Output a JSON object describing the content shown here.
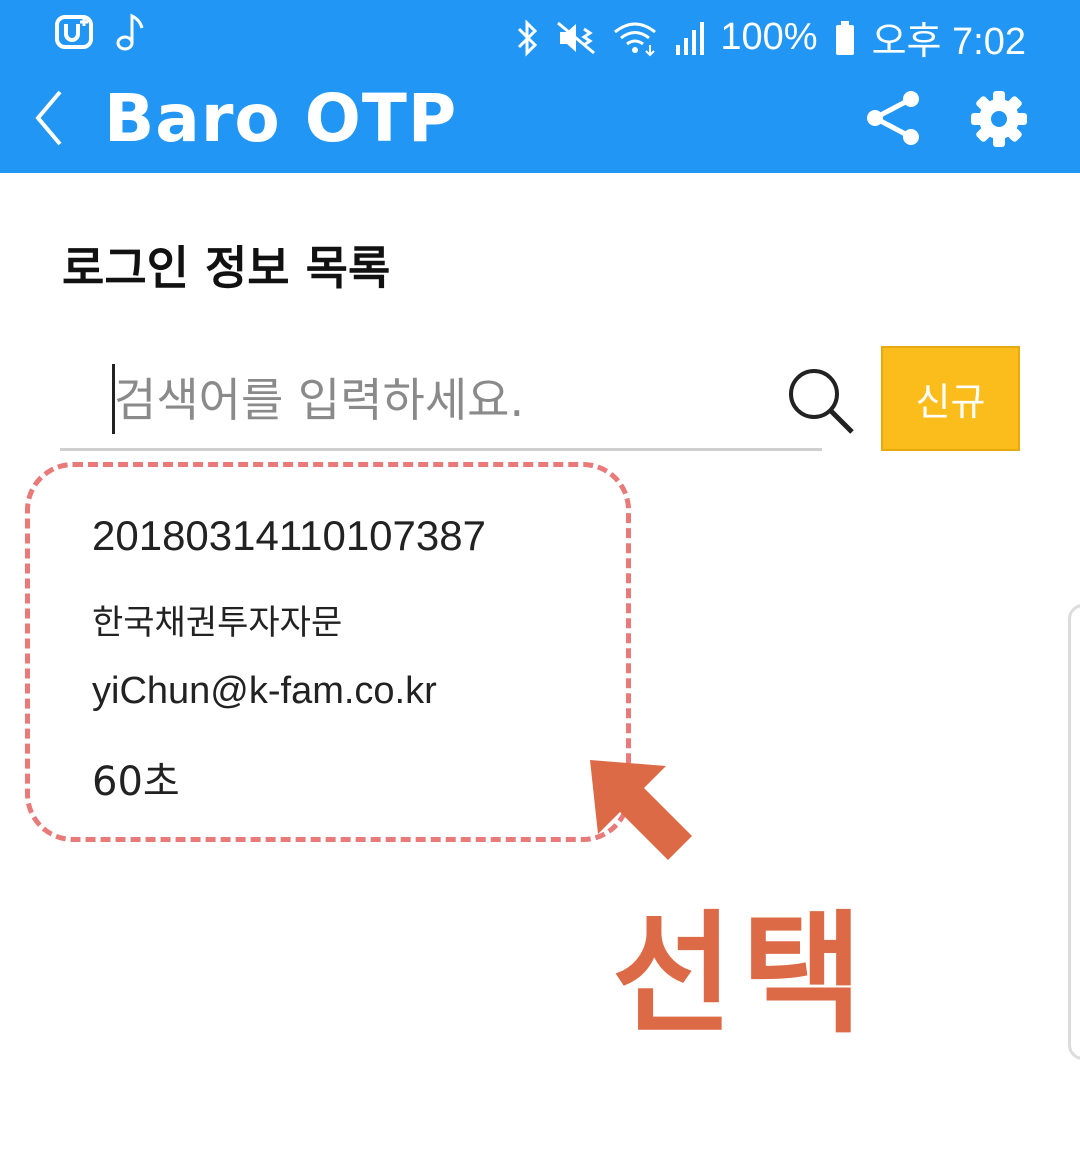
{
  "status_bar": {
    "battery": "100%",
    "time": "오후 7:02",
    "left_icons": [
      "u-plus-icon",
      "music-note-icon"
    ],
    "right_icons": [
      "bluetooth-icon",
      "mute-vibrate-icon",
      "wifi-icon",
      "signal-icon",
      "battery-icon"
    ]
  },
  "app_bar": {
    "title": "Baro OTP",
    "icons": [
      "back-icon",
      "share-icon",
      "gear-icon"
    ],
    "color": "#2196f5"
  },
  "main": {
    "section_title": "로그인 정보 목록",
    "search": {
      "placeholder": "검색어를 입력하세요.",
      "value": ""
    },
    "new_button_label": "신규",
    "new_button_color": "#fbbd1c",
    "items": [
      {
        "id": "20180314110107387",
        "company": "한국채권투자자문",
        "email": "yiChun@k-fam.co.kr",
        "interval": "60초"
      }
    ]
  },
  "annotation": {
    "label": "선택",
    "color": "#dd6a46",
    "highlight_color": "#e87a7a"
  }
}
